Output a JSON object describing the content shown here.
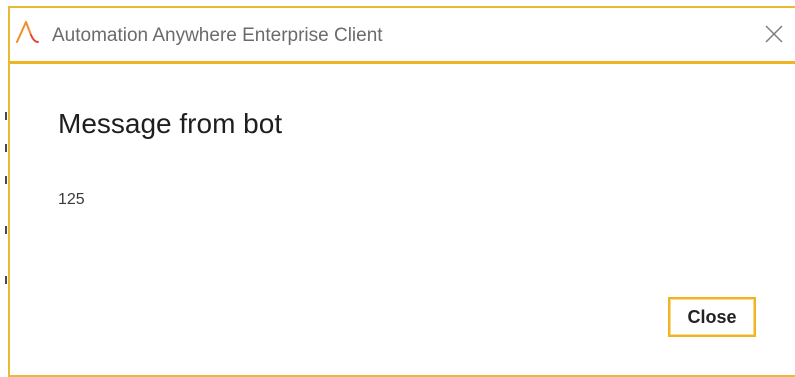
{
  "window": {
    "title": "Automation Anywhere Enterprise Client",
    "app_icon": "automation-anywhere-logo",
    "close_icon": "close-icon",
    "accent_color": "#f0b323"
  },
  "dialog": {
    "heading": "Message from bot",
    "message": "125",
    "close_button_label": "Close"
  }
}
